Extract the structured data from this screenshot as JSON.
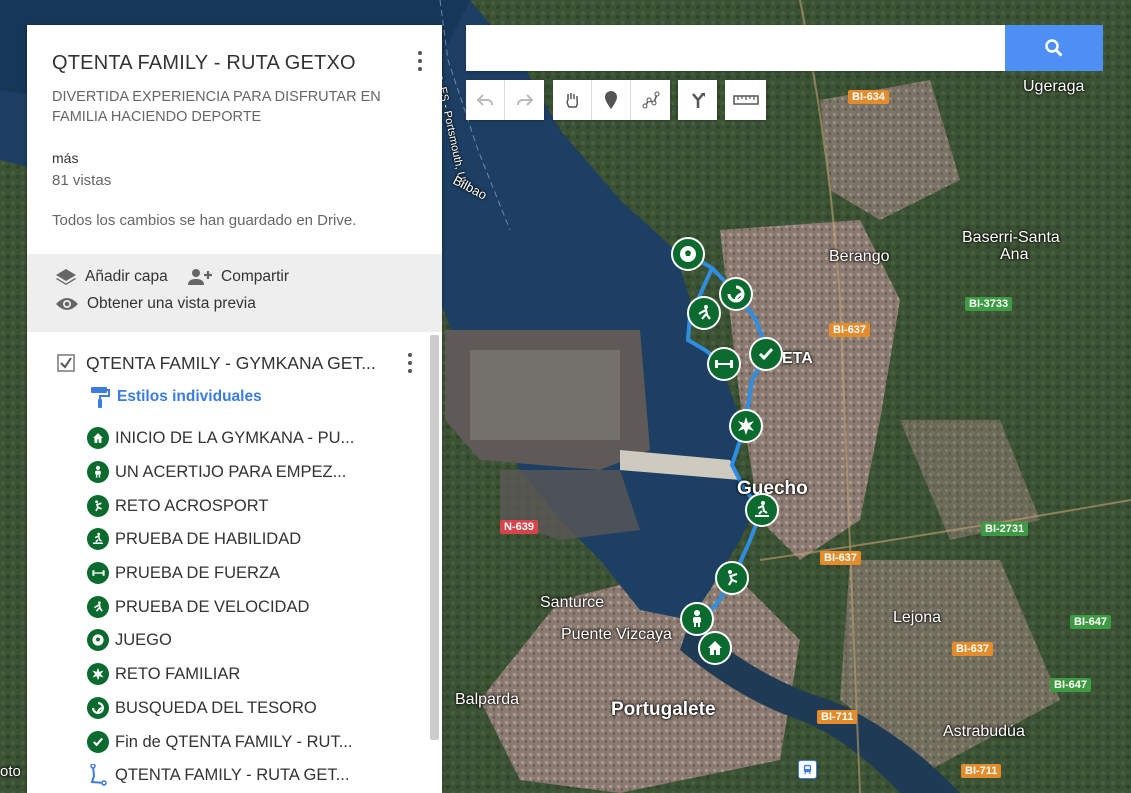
{
  "panel": {
    "title": "QTENTA FAMILY - RUTA GETXO",
    "description": "DIVERTIDA EXPERIENCIA PARA DISFRUTAR EN FAMILIA HACIENDO DEPORTE",
    "more": "más",
    "views": "81 vistas",
    "saved": "Todos los cambios se han guardado en Drive.",
    "add_layer": "Añadir capa",
    "share": "Compartir",
    "preview": "Obtener una vista previa",
    "layer": {
      "title": "QTENTA FAMILY - GYMKANA GET...",
      "styles": "Estilos individuales",
      "items": [
        {
          "label": "INICIO DE LA GYMKANA - PU...",
          "icon": "home-icon"
        },
        {
          "label": "UN ACERTIJO PARA EMPEZ...",
          "icon": "person-icon"
        },
        {
          "label": "RETO ACROSPORT",
          "icon": "gymnast-icon"
        },
        {
          "label": "PRUEBA DE HABILIDAD",
          "icon": "skateboard-icon"
        },
        {
          "label": "PRUEBA DE FUERZA",
          "icon": "dumbbell-icon"
        },
        {
          "label": "PRUEBA DE VELOCIDAD",
          "icon": "runner-icon"
        },
        {
          "label": "JUEGO",
          "icon": "soccer-ball-icon"
        },
        {
          "label": "RETO FAMILIAR",
          "icon": "star-burst-icon"
        },
        {
          "label": "BUSQUEDA DEL TESORO",
          "icon": "treasure-icon"
        },
        {
          "label": "Fin de QTENTA FAMILY - RUT...",
          "icon": "check-icon"
        },
        {
          "label": "QTENTA FAMILY - RUTA GET...",
          "icon": "route-line-icon"
        }
      ]
    }
  },
  "search": {
    "value": "",
    "placeholder": ""
  },
  "map": {
    "labels": [
      "Bilbao, ES - Portsmouth, UK",
      "Bilbao",
      "Ugeraga",
      "Berango",
      "Baserri-Santa",
      "Ana",
      "Guecho",
      "Santurce",
      "Puente Vizcaya",
      "Lejona",
      "Balparda",
      "Portugalete",
      "Astrabudúa",
      "oto",
      "ETA"
    ],
    "roads": [
      "BI-634",
      "BI-3733",
      "BI-637",
      "BI-637",
      "BI-2731",
      "N-639",
      "BI-647",
      "BI-637",
      "BI-647",
      "BI-711",
      "BI-711"
    ],
    "route_color": "#2f8ee0",
    "marker_color": "#0b6b2e"
  }
}
